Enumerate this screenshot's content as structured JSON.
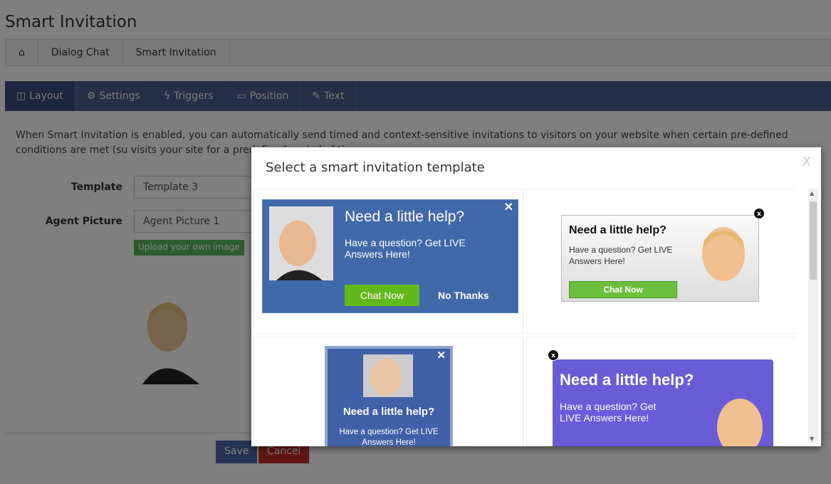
{
  "page": {
    "title": "Smart Invitation"
  },
  "breadcrumb": {
    "home_icon": "home-icon",
    "items": [
      "Dialog Chat",
      "Smart Invitation"
    ]
  },
  "tabs": [
    {
      "label": "Layout",
      "icon": "columns-icon"
    },
    {
      "label": "Settings",
      "icon": "gear-icon"
    },
    {
      "label": "Triggers",
      "icon": "bolt-icon"
    },
    {
      "label": "Position",
      "icon": "monitor-icon"
    },
    {
      "label": "Text",
      "icon": "edit-icon"
    }
  ],
  "description": "When Smart Invitation is enabled, you can automatically send timed and context-sensitive invitations to visitors on your website when certain pre-defined conditions are met (su visits your site for a predefined period of time or p",
  "form": {
    "template_label": "Template",
    "template_value": "Template 3",
    "agent_label": "Agent Picture",
    "agent_value": "Agent Picture 1",
    "upload_label": "Upload your own image"
  },
  "footer": {
    "save": "Save",
    "cancel": "Cancel"
  },
  "modal": {
    "title": "Select a smart invitation template",
    "close": "X",
    "templates": [
      {
        "heading": "Need a little help?",
        "body": "Have a question? Get LIVE Answers Here!",
        "chat": "Chat Now",
        "no": "No Thanks",
        "close": "✕"
      },
      {
        "heading": "Need a little help?",
        "body": "Have a question? Get LIVE Answers Here!",
        "chat": "Chat Now",
        "close": "x"
      },
      {
        "heading": "Need a little help?",
        "body": "Have a question? Get LIVE Answers Here!",
        "close": "✕"
      },
      {
        "heading": "Need a little help?",
        "body": "Have a question? Get LIVE Answers Here!",
        "close": "x"
      }
    ]
  },
  "colors": {
    "tabbar": "#4a5f94",
    "upload": "#5cb85c",
    "save": "#4a67a8",
    "cancel": "#c9302c",
    "template1": "#4168a8",
    "template4": "#6a5bd6",
    "chat_green": "#62b81c"
  }
}
